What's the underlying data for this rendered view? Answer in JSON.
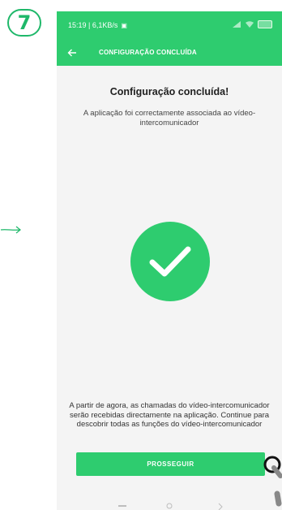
{
  "step_badge": {
    "number": "7"
  },
  "status_bar": {
    "time_speed": "15:19 | 6,1KB/s"
  },
  "app_bar": {
    "title": "CONFIGURAÇÃO CONCLUÍDA"
  },
  "content": {
    "title": "Configuração concluída!",
    "subtitle": "A aplicação foi correctamente associada ao vídeo-intercomunicador",
    "info": "A partir de agora, as chamadas do vídeo-intercomunicador serão recebidas directamente na aplicação. Continue para descobrir todas as funções do vídeo-intercomunicador"
  },
  "actions": {
    "proceed_label": "PROSSEGUIR"
  },
  "colors": {
    "accent": "#2ecc6f",
    "badge": "#1fb86a"
  },
  "icons": [
    "back-arrow-icon",
    "check-icon",
    "signal-icon",
    "wifi-icon",
    "battery-icon"
  ]
}
